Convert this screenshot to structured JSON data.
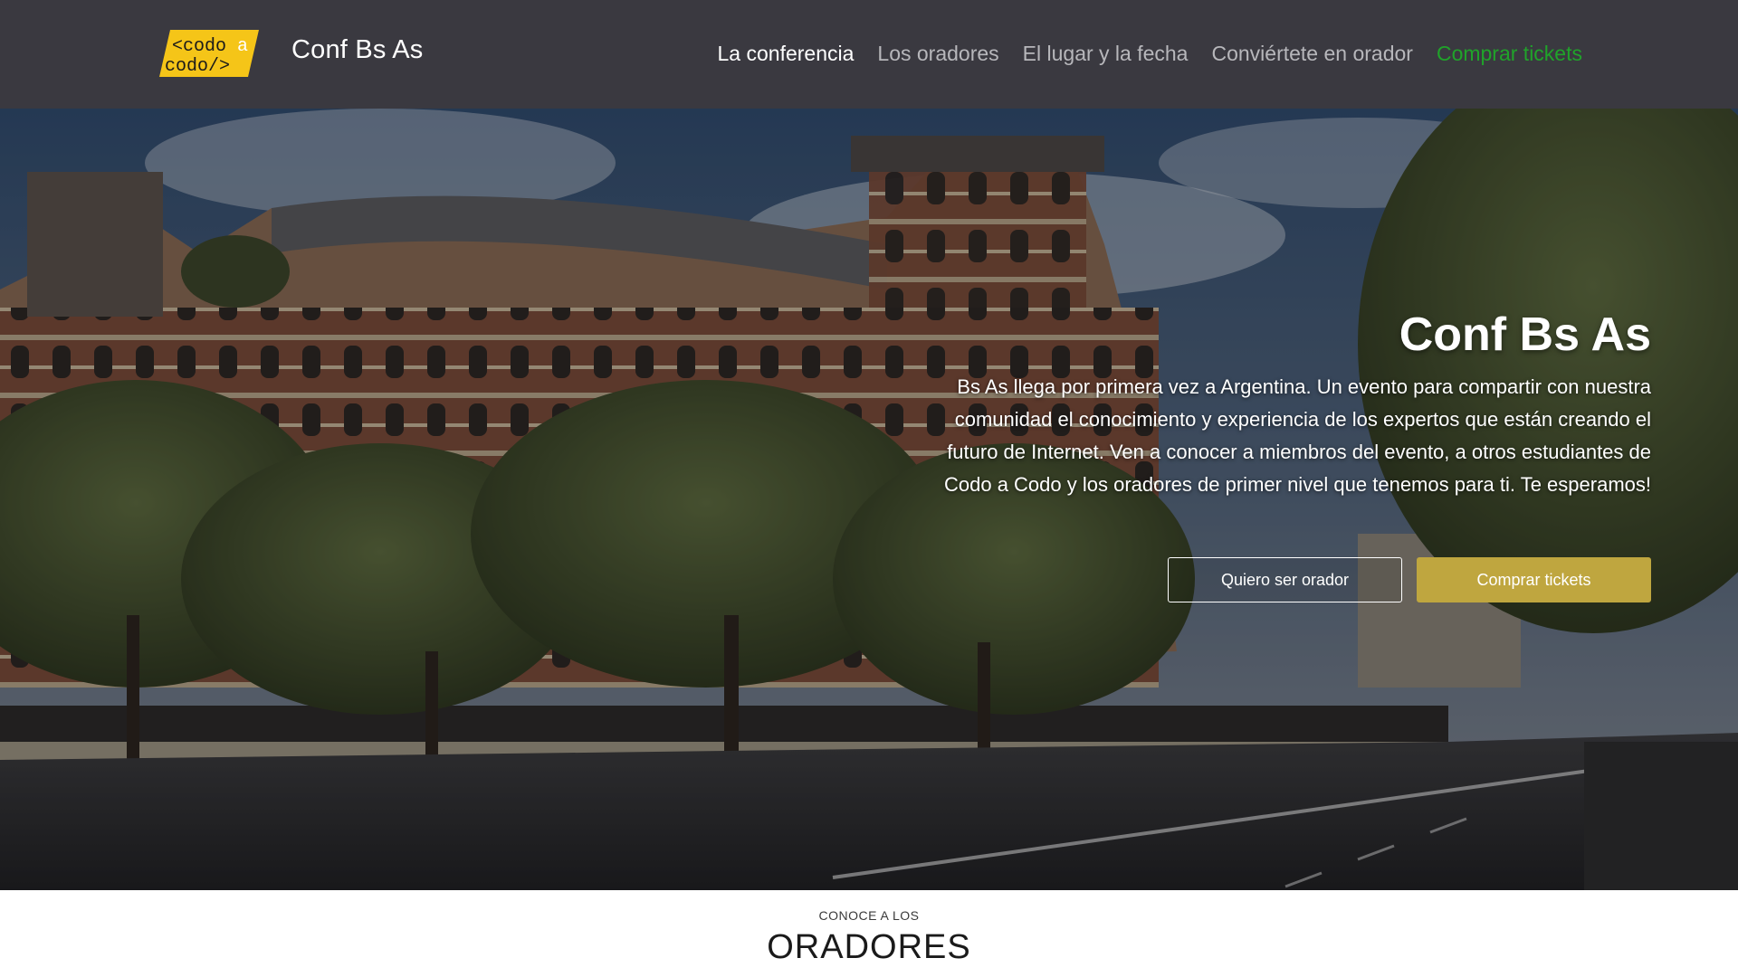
{
  "nav": {
    "logo_text_top": "<codo",
    "logo_text_top_right": "a",
    "logo_text_bottom": "codo/>",
    "brand": "Conf Bs As",
    "links": [
      {
        "label": "La conferencia",
        "state": "active"
      },
      {
        "label": "Los oradores",
        "state": "default"
      },
      {
        "label": "El lugar y la fecha",
        "state": "default"
      },
      {
        "label": "Conviértete en orador",
        "state": "default"
      },
      {
        "label": "Comprar tickets",
        "state": "cta"
      }
    ],
    "colors": {
      "bg": "#3a3940",
      "cta": "#20a32a",
      "logo": "#f5c518"
    }
  },
  "hero": {
    "title": "Conf Bs As",
    "text": "Bs As llega por primera vez a Argentina. Un evento para compartir con nuestra comunidad el conocimiento y experiencia de los expertos que están creando el futuro de Internet. Ven a conocer a miembros del evento, a otros estudiantes de Codo a Codo y los oradores de primer nivel que tenemos para ti. Te esperamos!",
    "button_speaker": "Quiero ser orador",
    "button_tickets": "Comprar tickets",
    "background": "building-photo",
    "colors": {
      "tickets_button": "#bfa63f"
    }
  },
  "speakers_section": {
    "kicker": "CONOCE A LOS",
    "title": "ORADORES"
  }
}
